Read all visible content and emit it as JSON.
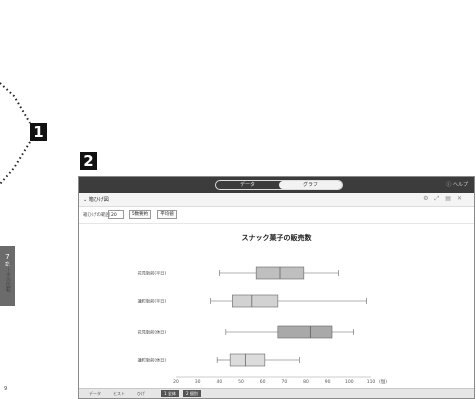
{
  "markers": {
    "one": "1",
    "two": "2"
  },
  "side_tab": {
    "line1": "7",
    "line2": "章",
    "text": "データの比較"
  },
  "page_number": "9",
  "app": {
    "segments": {
      "left": "データ",
      "right": "グラフ"
    },
    "help_label": "ヘルプ",
    "graph_title": "箱ひげ図",
    "controls": {
      "class_width_label": "箱ひげの範囲",
      "class_width_value": "20",
      "button_five_summary": "5数要約",
      "button_mean": "平均値"
    },
    "bottom": {
      "items": [
        "データ",
        "ヒスト",
        "ひげ"
      ],
      "dark_items": [
        "1 全体",
        "2 個別"
      ]
    }
  },
  "chart_data": {
    "type": "boxplot",
    "title": "スナック菓子の販売数",
    "xlabel": "(個)",
    "xlim": [
      20,
      110
    ],
    "xticks": [
      20,
      30,
      40,
      50,
      60,
      70,
      80,
      90,
      100,
      110
    ],
    "categories": [
      "花見駅前(平日)",
      "蓮町駅前(平日)",
      "花見駅前(休日)",
      "蓮町駅前(休日)"
    ],
    "series": [
      {
        "min": 40,
        "q1": 57,
        "median": 68,
        "q3": 79,
        "max": 95,
        "color": "#bfbfbf"
      },
      {
        "min": 36,
        "q1": 46,
        "median": 55,
        "q3": 67,
        "max": 108,
        "color": "#d2d2d2"
      },
      {
        "min": 43,
        "q1": 67,
        "median": 82,
        "q3": 92,
        "max": 102,
        "color": "#a9a9a9"
      },
      {
        "min": 39,
        "q1": 45,
        "median": 52,
        "q3": 61,
        "max": 77,
        "color": "#dcdcdc"
      }
    ],
    "grid": false
  }
}
